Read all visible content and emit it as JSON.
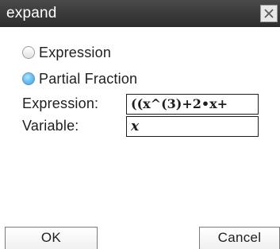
{
  "window": {
    "title": "expand",
    "close_icon": "close-icon"
  },
  "options": [
    {
      "label": "Expression",
      "selected": false
    },
    {
      "label": "Partial Fraction",
      "selected": true
    }
  ],
  "fields": {
    "expression": {
      "label": "Expression:",
      "value": "((x^(3)+2•x+"
    },
    "variable": {
      "label": "Variable:",
      "value": "x"
    }
  },
  "buttons": {
    "ok": "OK",
    "cancel": "Cancel"
  },
  "colors": {
    "titlebar": "#3a3a3a",
    "radio_selected": "#6ec3f6"
  }
}
